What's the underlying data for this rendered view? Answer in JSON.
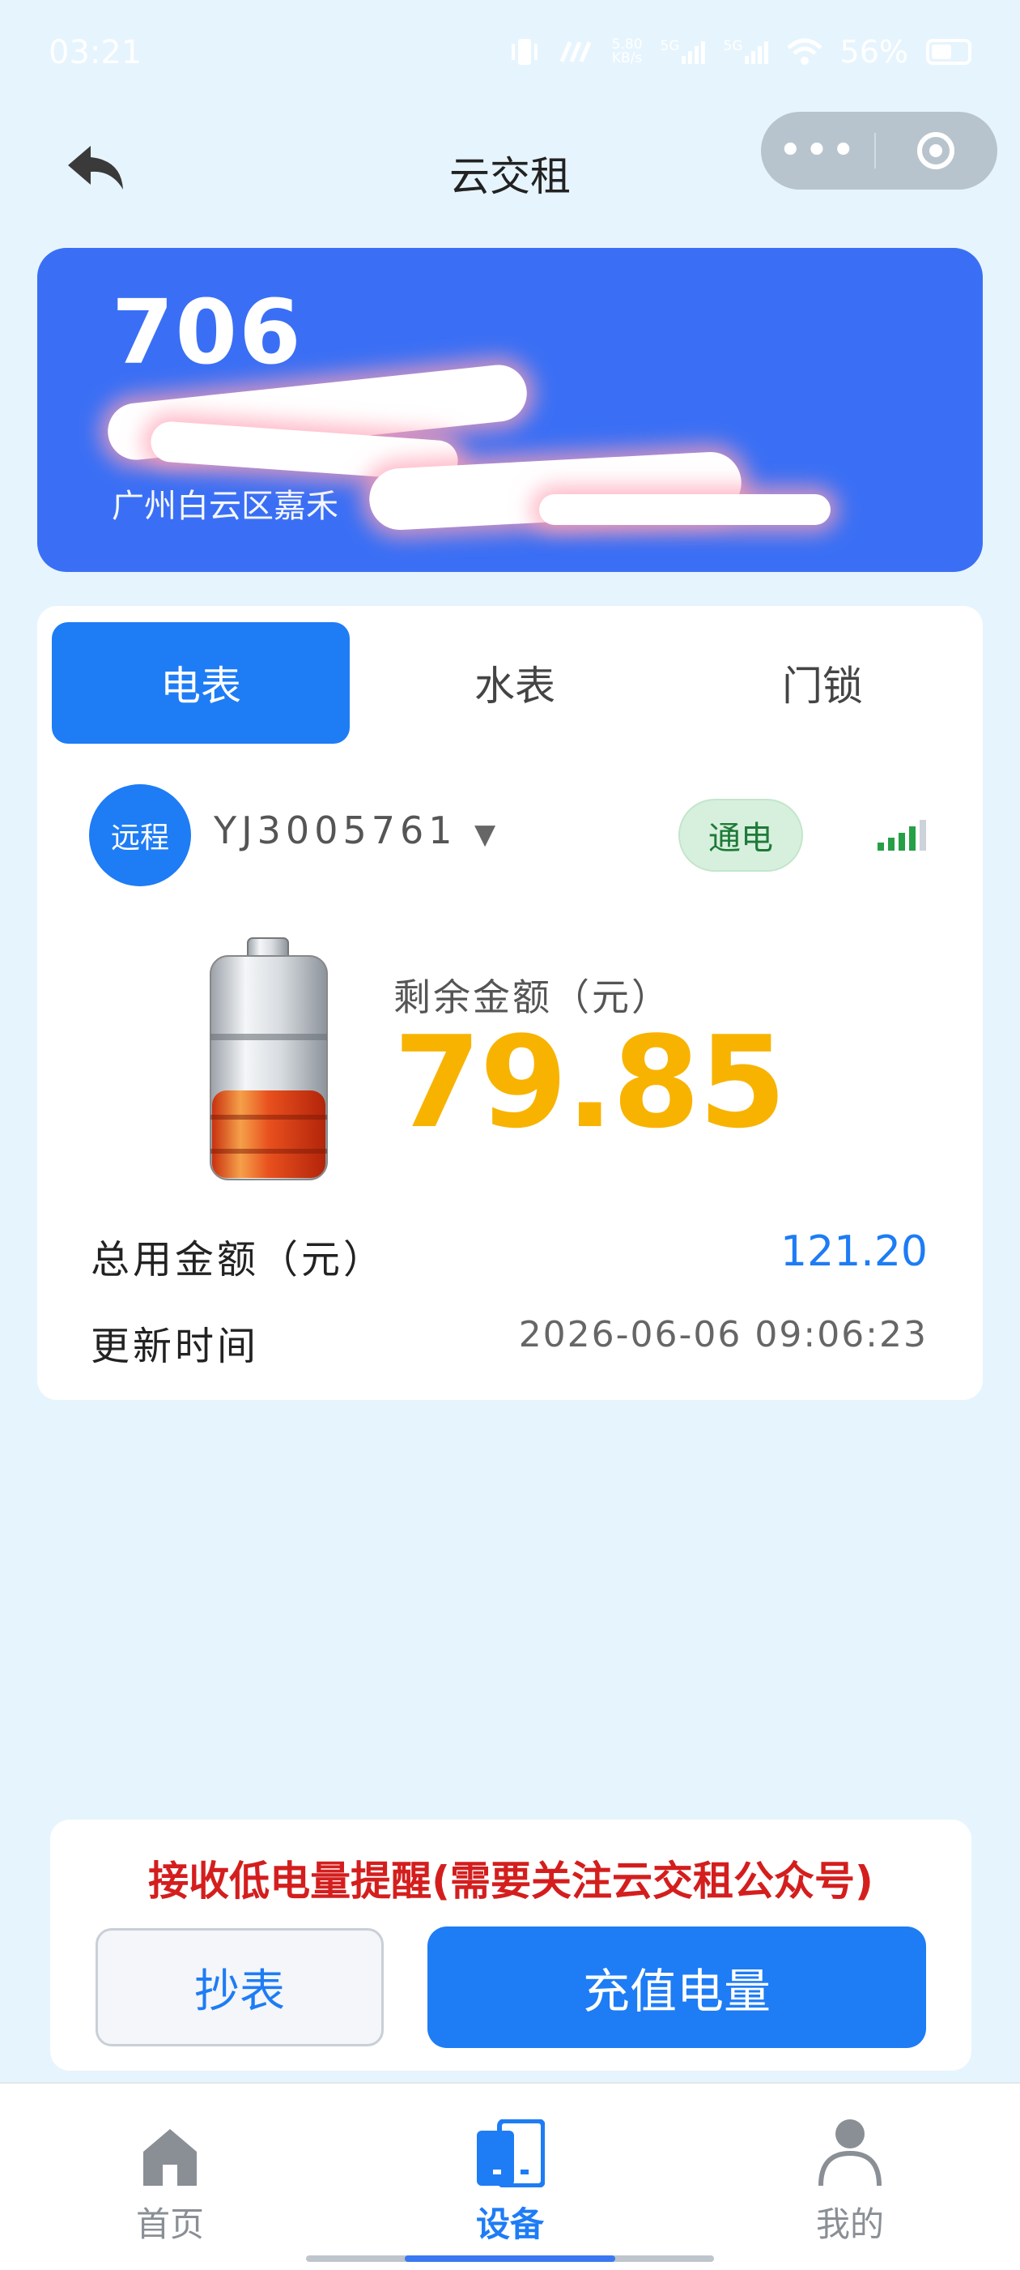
{
  "status_bar": {
    "time": "03:21",
    "net_speed_top": "5.80",
    "net_speed_unit": "KB/s",
    "sim1": "5G",
    "sim2": "5G",
    "battery": "56%"
  },
  "header": {
    "title": "云交租"
  },
  "room": {
    "number": "706",
    "address": "广州白云区嘉禾"
  },
  "tabs": [
    {
      "label": "电表",
      "active": true
    },
    {
      "label": "水表",
      "active": false
    },
    {
      "label": "门锁",
      "active": false
    }
  ],
  "meter": {
    "mode_badge": "远程",
    "device_id": "YJ3005761",
    "dropdown_symbol": "▼",
    "power_status": "通电",
    "remaining_label": "剩余金额（元）",
    "remaining_value": "79.85",
    "battery_level": 0.4,
    "total_label": "总用金额（元）",
    "total_value": "121.20",
    "updated_label": "更新时间",
    "updated_value": "2026-06-06 09:06:23"
  },
  "actions": {
    "notice": "接收低电量提醒(需要关注云交租公众号)",
    "read_button": "抄表",
    "charge_button": "充值电量"
  },
  "nav": [
    {
      "label": "首页",
      "icon": "home-icon"
    },
    {
      "label": "设备",
      "icon": "device-icon",
      "active": true
    },
    {
      "label": "我的",
      "icon": "user-icon"
    }
  ],
  "colors": {
    "primary": "#1e7cf5",
    "room_card": "#3a6ff5",
    "amount": "#f8b300",
    "notice": "#d41e1e",
    "background": "#e6f4fd"
  }
}
